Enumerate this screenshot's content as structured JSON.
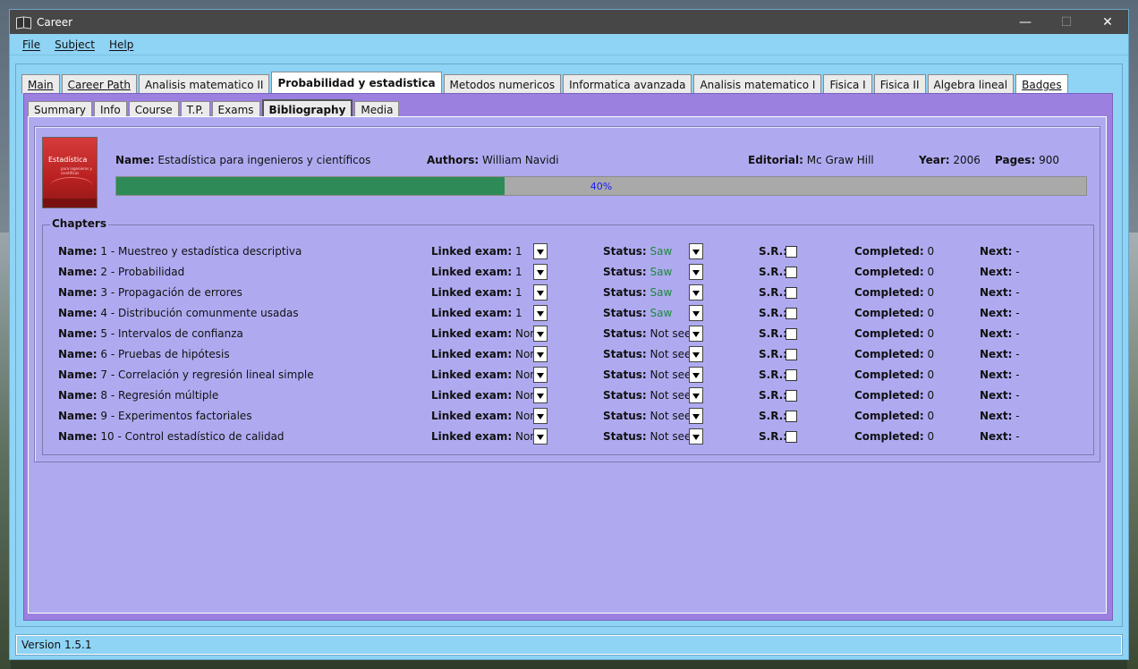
{
  "window": {
    "title": "Career"
  },
  "menu": [
    "File",
    "Subject",
    "Help"
  ],
  "top_tabs": [
    "Main",
    "Career Path",
    "Analisis matematico II",
    "Probabilidad y estadistica",
    "Metodos numericos",
    "Informatica avanzada",
    "Analisis matematico I",
    "Fisica I",
    "Fisica II",
    "Algebra lineal",
    "Badges"
  ],
  "active_top_tab": "Probabilidad y estadistica",
  "sub_tabs": [
    "Summary",
    "Info",
    "Course",
    "T.P.",
    "Exams",
    "Bibliography",
    "Media"
  ],
  "active_sub_tab": "Bibliography",
  "book": {
    "cover_title": "Estadística",
    "cover_subtitle": "para ingenieros y científicos",
    "name_label": "Name:",
    "name": "Estadística para ingenieros y científicos",
    "authors_label": "Authors:",
    "authors": "William Navidi",
    "editorial_label": "Editorial:",
    "editorial": "Mc Graw Hill",
    "year_label": "Year:",
    "year": "2006",
    "pages_label": "Pages:",
    "pages": "900",
    "progress_percent": 40,
    "progress_text": "40%"
  },
  "chapters_title": "Chapters",
  "labels": {
    "name": "Name:",
    "linked_exam": "Linked exam:",
    "status": "Status:",
    "sr": "S.R.:",
    "completed": "Completed:",
    "next": "Next:"
  },
  "chapters": [
    {
      "name": "1 - Muestreo y estadística descriptiva",
      "linked_exam": "1",
      "status": "Saw",
      "sr": false,
      "completed": "0",
      "next": "-"
    },
    {
      "name": "2 - Probabilidad",
      "linked_exam": "1",
      "status": "Saw",
      "sr": false,
      "completed": "0",
      "next": "-"
    },
    {
      "name": "3 - Propagación de errores",
      "linked_exam": "1",
      "status": "Saw",
      "sr": false,
      "completed": "0",
      "next": "-"
    },
    {
      "name": "4 - Distribución comunmente usadas",
      "linked_exam": "1",
      "status": "Saw",
      "sr": false,
      "completed": "0",
      "next": "-"
    },
    {
      "name": "5 - Intervalos de confianza",
      "linked_exam": "None",
      "status": "Not seen",
      "sr": false,
      "completed": "0",
      "next": "-"
    },
    {
      "name": "6 - Pruebas de hipótesis",
      "linked_exam": "None",
      "status": "Not seen",
      "sr": false,
      "completed": "0",
      "next": "-"
    },
    {
      "name": "7 - Correlación y regresión lineal simple",
      "linked_exam": "None",
      "status": "Not seen",
      "sr": false,
      "completed": "0",
      "next": "-"
    },
    {
      "name": "8 - Regresión múltiple",
      "linked_exam": "None",
      "status": "Not seen",
      "sr": false,
      "completed": "0",
      "next": "-"
    },
    {
      "name": "9 - Experimentos factoriales",
      "linked_exam": "None",
      "status": "Not seen",
      "sr": false,
      "completed": "0",
      "next": "-"
    },
    {
      "name": "10 - Control estadístico de calidad",
      "linked_exam": "None",
      "status": "Not seen",
      "sr": false,
      "completed": "0",
      "next": "-"
    }
  ],
  "status_bar": "Version 1.5.1",
  "colors": {
    "saw": "#1b8a3a",
    "progress": "#2e8b57",
    "panel": "#afaaf0",
    "frame": "#9b80e0",
    "window": "#8fd3f5"
  }
}
